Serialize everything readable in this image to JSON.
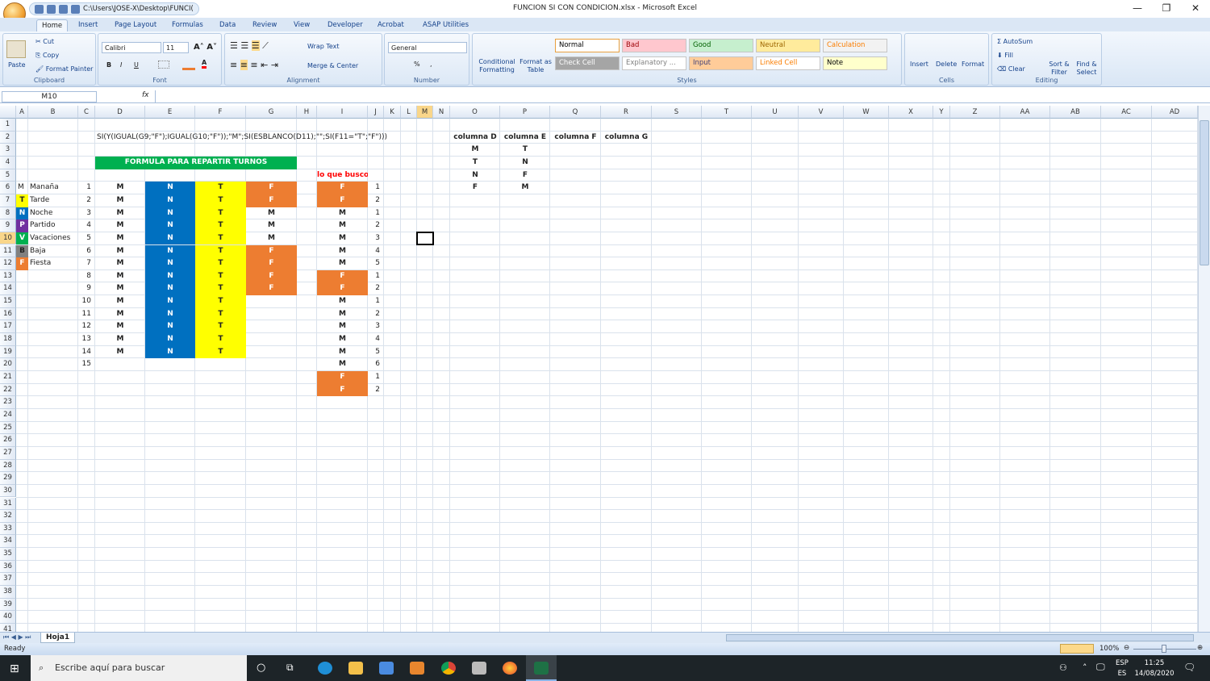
{
  "window": {
    "title": "FUNCION SI CON CONDICION.xlsx - Microsoft Excel",
    "path": "C:\\Users\\JOSE-X\\Desktop\\FUNCI(",
    "controls": [
      "—",
      "❐",
      "✕"
    ]
  },
  "tabs": [
    "Home",
    "Insert",
    "Page Layout",
    "Formulas",
    "Data",
    "Review",
    "View",
    "Developer",
    "Acrobat",
    "ASAP Utilities"
  ],
  "ribbon": {
    "clipboard": {
      "label": "Clipboard",
      "paste": "Paste",
      "cut": "Cut",
      "copy": "Copy",
      "format_painter": "Format Painter"
    },
    "font": {
      "label": "Font",
      "name": "Calibri",
      "size": "11",
      "bold": "B",
      "italic": "I",
      "underline": "U"
    },
    "alignment": {
      "label": "Alignment",
      "wrap": "Wrap Text",
      "merge": "Merge & Center"
    },
    "number": {
      "label": "Number",
      "format": "General",
      "percent": "%",
      "comma": ","
    },
    "styles": {
      "label": "Styles",
      "conditional": "Conditional Formatting",
      "format_table": "Format as Table",
      "cells": [
        {
          "label": "Normal",
          "bg": "#ffffff",
          "fg": "#000000"
        },
        {
          "label": "Bad",
          "bg": "#ffc7ce",
          "fg": "#9c0006"
        },
        {
          "label": "Good",
          "bg": "#c6efce",
          "fg": "#006100"
        },
        {
          "label": "Neutral",
          "bg": "#ffeb9c",
          "fg": "#9c6500"
        },
        {
          "label": "Calculation",
          "bg": "#f2f2f2",
          "fg": "#fa7d00"
        },
        {
          "label": "Check Cell",
          "bg": "#a5a5a5",
          "fg": "#ffffff"
        },
        {
          "label": "Explanatory ...",
          "bg": "#ffffff",
          "fg": "#7f7f7f"
        },
        {
          "label": "Input",
          "bg": "#ffcc99",
          "fg": "#3f3f76"
        },
        {
          "label": "Linked Cell",
          "bg": "#ffffff",
          "fg": "#fa7d00"
        },
        {
          "label": "Note",
          "bg": "#ffffcc",
          "fg": "#000000"
        }
      ]
    },
    "cells": {
      "label": "Cells",
      "insert": "Insert",
      "delete": "Delete",
      "format": "Format"
    },
    "editing": {
      "label": "Editing",
      "autosum": "AutoSum",
      "fill": "Fill",
      "clear": "Clear",
      "sort": "Sort & Filter",
      "find": "Find & Select"
    }
  },
  "formula_bar": {
    "name_box": "M10",
    "fx": "fx",
    "value": ""
  },
  "colors": {
    "green": "#00b050",
    "blue": "#0070c0",
    "yellow": "#ffff00",
    "orange": "#ed7d31",
    "purple": "#7030a0",
    "gray": "#808080",
    "red": "#ff0000"
  },
  "sheet": {
    "columns": [
      "A",
      "B",
      "C",
      "D",
      "E",
      "F",
      "G",
      "H",
      "I",
      "J",
      "K",
      "L",
      "M",
      "N",
      "O",
      "P",
      "Q",
      "R",
      "S",
      "T",
      "U",
      "V",
      "W",
      "X",
      "Y",
      "Z",
      "AA",
      "AB",
      "AC",
      "AD"
    ],
    "selected": "M10",
    "cells": [
      {
        "ref": "D2",
        "v": "SI(Y(IGUAL(G9;\"F\");IGUAL(G10;\"F\"));\"M\";SI(ESBLANCO(D11);\"\";SI(F11=\"T\";\"F\")))"
      },
      {
        "ref": "D4",
        "v": "FORMULA PARA REPARTIR TURNOS",
        "fill": "green",
        "span": 4,
        "b": 1,
        "fg": "#ffffff",
        "c": 1
      },
      {
        "ref": "I5",
        "v": "lo que busco",
        "b": 1,
        "fg": "#ff0000",
        "c": 1
      },
      {
        "ref": "A6",
        "v": "M"
      },
      {
        "ref": "B6",
        "v": "Manaña"
      },
      {
        "ref": "A7",
        "v": "T",
        "fill": "yellow",
        "b": 1,
        "c": 1
      },
      {
        "ref": "B7",
        "v": "Tarde"
      },
      {
        "ref": "A8",
        "v": "N",
        "fill": "blue",
        "fg": "#ffffff",
        "b": 1,
        "c": 1
      },
      {
        "ref": "B8",
        "v": "Noche"
      },
      {
        "ref": "A9",
        "v": "P",
        "fill": "purple",
        "fg": "#ffffff",
        "b": 1,
        "c": 1
      },
      {
        "ref": "B9",
        "v": "Partido"
      },
      {
        "ref": "A10",
        "v": "V",
        "fill": "green",
        "fg": "#ffffff",
        "b": 1,
        "c": 1
      },
      {
        "ref": "B10",
        "v": "Vacaciones"
      },
      {
        "ref": "A11",
        "v": "B",
        "fill": "gray",
        "b": 1,
        "c": 1
      },
      {
        "ref": "B11",
        "v": "Baja"
      },
      {
        "ref": "A12",
        "v": "F",
        "fill": "orange",
        "fg": "#ffffff",
        "b": 1,
        "c": 1
      },
      {
        "ref": "B12",
        "v": "Fiesta"
      },
      {
        "ref": "O2",
        "v": "columna D",
        "b": 1,
        "c": 1
      },
      {
        "ref": "P2",
        "v": "columna E",
        "b": 1,
        "c": 1
      },
      {
        "ref": "Q2",
        "v": "columna F",
        "b": 1,
        "c": 1
      },
      {
        "ref": "R2",
        "v": "columna G",
        "b": 1,
        "c": 1
      },
      {
        "ref": "O3",
        "v": "M",
        "b": 1,
        "c": 1
      },
      {
        "ref": "O4",
        "v": "T",
        "b": 1,
        "c": 1
      },
      {
        "ref": "O5",
        "v": "N",
        "b": 1,
        "c": 1
      },
      {
        "ref": "O6",
        "v": "F",
        "b": 1,
        "c": 1
      },
      {
        "ref": "P3",
        "v": "T",
        "b": 1,
        "c": 1
      },
      {
        "ref": "P4",
        "v": "N",
        "b": 1,
        "c": 1
      },
      {
        "ref": "P5",
        "v": "F",
        "b": 1,
        "c": 1
      },
      {
        "ref": "P6",
        "v": "M",
        "b": 1,
        "c": 1
      }
    ],
    "col_C": [
      1,
      2,
      3,
      4,
      5,
      6,
      7,
      8,
      9,
      10,
      11,
      12,
      13,
      14,
      15
    ],
    "col_D": [
      "M",
      "M",
      "M",
      "M",
      "M",
      "M",
      "M",
      "M",
      "M",
      "M",
      "M",
      "M",
      "M",
      "M"
    ],
    "col_E": [
      "N",
      "N",
      "N",
      "N",
      "N",
      "N",
      "N",
      "N",
      "N",
      "N",
      "N",
      "N",
      "N",
      "N"
    ],
    "col_F": [
      "T",
      "T",
      "T",
      "T",
      "T",
      "T",
      "T",
      "T",
      "T",
      "T",
      "T",
      "T",
      "T",
      "T"
    ],
    "col_G": [
      "F",
      "F",
      "M",
      "M",
      "M",
      "F",
      "F",
      "F",
      "F"
    ],
    "col_I": [
      "F",
      "F",
      "M",
      "M",
      "M",
      "M",
      "M",
      "F",
      "F",
      "M",
      "M",
      "M",
      "M",
      "M",
      "M",
      "F",
      "F"
    ],
    "col_J": [
      1,
      2,
      1,
      2,
      3,
      4,
      5,
      1,
      2,
      1,
      2,
      3,
      4,
      5,
      6,
      1,
      2
    ],
    "sheet_tab": "Hoja1"
  },
  "status": {
    "ready": "Ready",
    "zoom": "100%",
    "zoom_level": 100
  },
  "taskbar": {
    "search_placeholder": "Escribe aquí para buscar",
    "lang1": "ESP",
    "lang2": "ES",
    "time": "11:25",
    "date": "14/08/2020"
  }
}
